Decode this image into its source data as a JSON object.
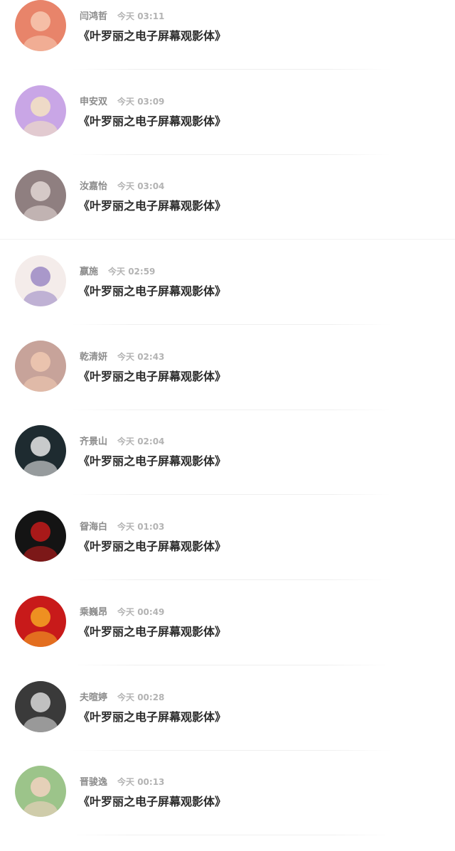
{
  "comments": [
    {
      "name": "闫鸿哲",
      "time": "今天 03:11",
      "content": "《叶罗丽之电子屏幕观影体》",
      "avatar": "red-sketch-avatar",
      "bg": "#e8846a",
      "fg": "#f7c8b0"
    },
    {
      "name": "申安双",
      "time": "今天 03:09",
      "content": "《叶罗丽之电子屏幕观影体》",
      "avatar": "anime-girl-avatar",
      "bg": "#c9a6e6",
      "fg": "#f4e3c1"
    },
    {
      "name": "汝嘉怡",
      "time": "今天 03:04",
      "content": "《叶罗丽之电子屏幕观影体》",
      "avatar": "cat-avatar",
      "bg": "#8f7f80",
      "fg": "#e2d6d4"
    },
    {
      "name": "嬴施",
      "time": "今天 02:59",
      "content": "《叶罗丽之电子屏幕观影体》",
      "avatar": "flowers-avatar",
      "bg": "#f4ecea",
      "fg": "#9b8ac4"
    },
    {
      "name": "乾清妍",
      "time": "今天 02:43",
      "content": "《叶罗丽之电子屏幕观影体》",
      "avatar": "girl-portrait-avatar",
      "bg": "#c7a39a",
      "fg": "#f0c9b2"
    },
    {
      "name": "齐景山",
      "time": "今天 02:04",
      "content": "《叶罗丽之电子屏幕观影体》",
      "avatar": "boy-glasses-avatar",
      "bg": "#1e2b30",
      "fg": "#e6e6e6"
    },
    {
      "name": "眢海白",
      "time": "今天 01:03",
      "content": "《叶罗丽之电子屏幕观影体》",
      "avatar": "dark-anime-avatar",
      "bg": "#141414",
      "fg": "#c21a1a"
    },
    {
      "name": "乘巍昂",
      "time": "今天 00:49",
      "content": "《叶罗丽之电子屏幕观影体》",
      "avatar": "pumpkin-avatar",
      "bg": "#c81a1a",
      "fg": "#f5a623"
    },
    {
      "name": "夫暄婷",
      "time": "今天 00:28",
      "content": "《叶罗丽之电子屏幕观影体》",
      "avatar": "hooded-figure-avatar",
      "bg": "#3a3a3a",
      "fg": "#d8d8d8"
    },
    {
      "name": "晋骏逸",
      "time": "今天 00:13",
      "content": "《叶罗丽之电子屏幕观影体》",
      "avatar": "girl-hat-avatar",
      "bg": "#9cc48a",
      "fg": "#f2d2c0"
    }
  ]
}
